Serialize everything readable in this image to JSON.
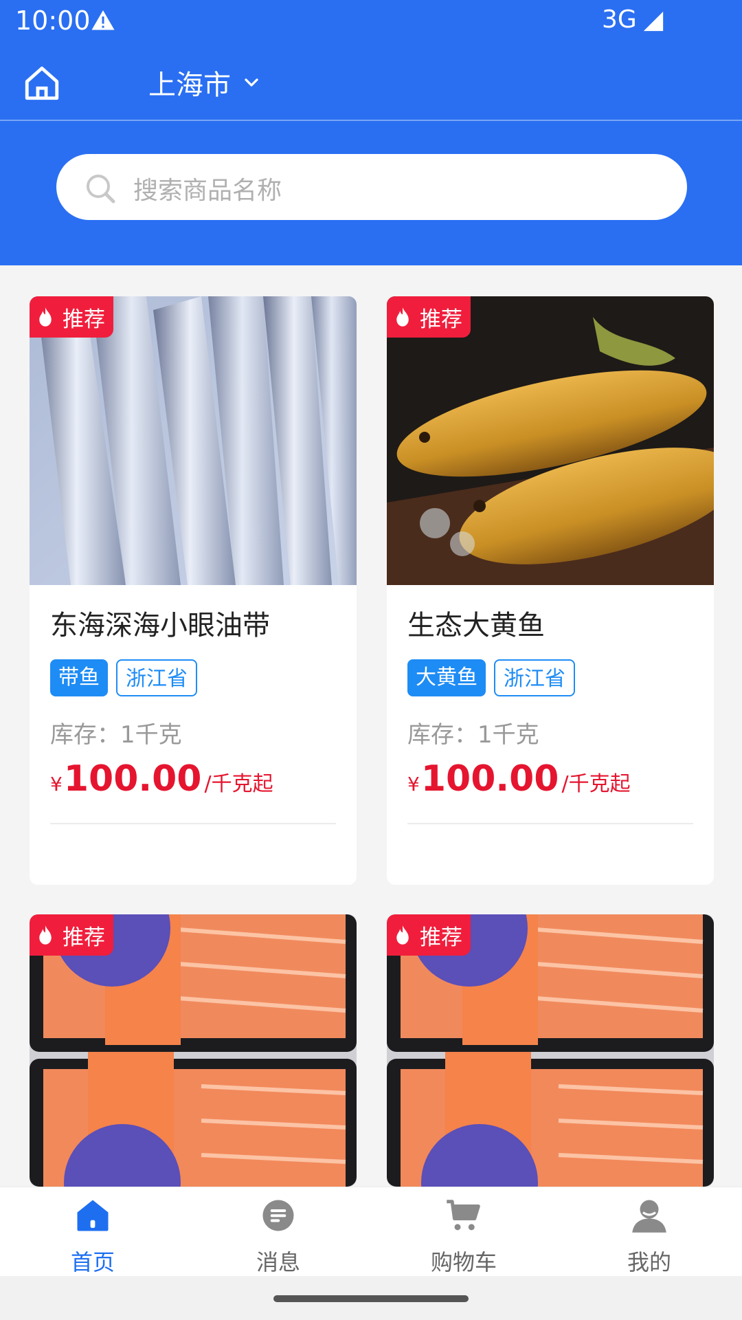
{
  "status_bar": {
    "time": "10:00",
    "network": "3G"
  },
  "header": {
    "city": "上海市"
  },
  "search": {
    "placeholder": "搜索商品名称"
  },
  "products": [
    {
      "badge": "推荐",
      "title": "东海深海小眼油带",
      "tag_primary": "带鱼",
      "tag_origin": "浙江省",
      "stock": "库存：1千克",
      "currency": "¥",
      "price": "100.00",
      "unit": "/千克起",
      "image": "belt-fish-photo"
    },
    {
      "badge": "推荐",
      "title": "生态大黄鱼",
      "tag_primary": "大黄鱼",
      "tag_origin": "浙江省",
      "stock": "库存：1千克",
      "currency": "¥",
      "price": "100.00",
      "unit": "/千克起",
      "image": "yellow-croaker-photo"
    },
    {
      "badge": "推荐",
      "image": "salmon-sashimi-photo"
    },
    {
      "badge": "推荐",
      "image": "salmon-sashimi-photo"
    }
  ],
  "tab_bar": {
    "items": [
      {
        "label": "首页",
        "icon": "home-tab-icon",
        "active": true
      },
      {
        "label": "消息",
        "icon": "message-icon",
        "active": false
      },
      {
        "label": "购物车",
        "icon": "cart-icon",
        "active": false
      },
      {
        "label": "我的",
        "icon": "profile-icon",
        "active": false
      }
    ]
  },
  "colors": {
    "primary": "#2a6ff2",
    "badge": "#f01e3c",
    "price": "#e5152f",
    "tag": "#1e8cf5"
  }
}
